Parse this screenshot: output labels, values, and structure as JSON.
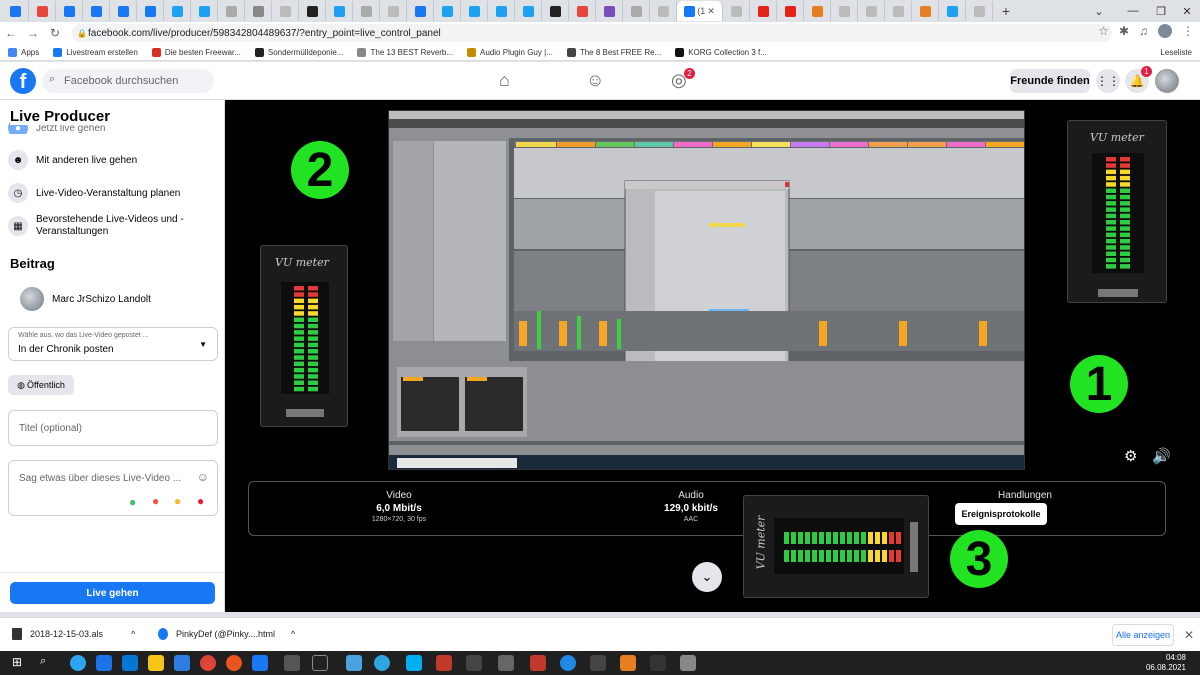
{
  "browser": {
    "active_tab_label": "(1",
    "url": "facebook.com/live/producer/598342804489637/?entry_point=live_control_panel",
    "bookmarks": [
      {
        "label": "Apps",
        "color": "#4285f4"
      },
      {
        "label": "Livestream erstellen",
        "color": "#1877f2"
      },
      {
        "label": "Die besten Freewar...",
        "color": "#d93025"
      },
      {
        "label": "Sondermülldeponie...",
        "color": "#222222"
      },
      {
        "label": "The 13 BEST Reverb...",
        "color": "#888888"
      },
      {
        "label": "Audio Plugin Guy |...",
        "color": "#c58a00"
      },
      {
        "label": "The 8 Best FREE Re...",
        "color": "#444444"
      },
      {
        "label": "KORG Collection 3 f...",
        "color": "#111111"
      }
    ],
    "reading_list": "Leseliste"
  },
  "fb": {
    "search_placeholder": "Facebook durchsuchen",
    "groups_badge": "2",
    "notif_badge": "1",
    "friends_button": "Freunde finden"
  },
  "sidebar": {
    "title": "Live Producer",
    "partial_item": "Jetzt live gehen",
    "items": [
      {
        "label": "Mit anderen live gehen"
      },
      {
        "label": "Live-Video-Veranstaltung planen"
      },
      {
        "label": "Bevorstehende Live-Videos und - Veranstaltungen"
      }
    ],
    "post_heading": "Beitrag",
    "user_name": "Marc JrSchizo Landolt",
    "destination_label": "Wähle aus, wo das Live-Video gepostet ...",
    "destination_value": "In der Chronik posten",
    "privacy": "Öffentlich",
    "title_placeholder": "Titel (optional)",
    "desc_placeholder": "Sag etwas über dieses Live-Video ...",
    "go_live": "Live gehen"
  },
  "main": {
    "number_1": "1",
    "number_2": "2",
    "number_3": "3",
    "vu_title": "VU meter",
    "video": {
      "heading": "Video",
      "value": "6,0 Mbit/s",
      "sub": "1280×720, 30 fps"
    },
    "audio": {
      "heading": "Audio",
      "value": "129,0 kbit/s",
      "sub": "AAC"
    },
    "actions": {
      "heading": "Handlungen",
      "button": "Ereignisprotokolle"
    }
  },
  "downloads": {
    "files": [
      "2018-12-15-03.als",
      "PinkyDef (@Pinky....html"
    ],
    "show_all": "Alle anzeigen"
  },
  "taskbar": {
    "time": "04:08",
    "date": "06.08.2021"
  },
  "colors": {
    "fb_blue": "#1877f2",
    "badge_red": "#e41e3f",
    "number_green": "#22e322"
  }
}
